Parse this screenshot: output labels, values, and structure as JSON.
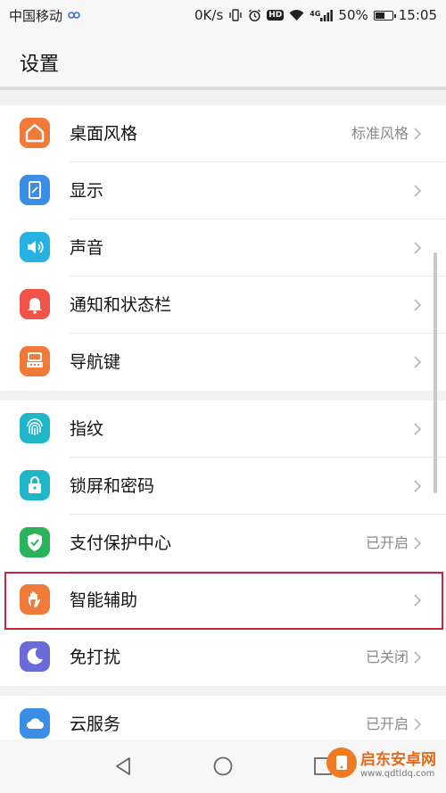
{
  "status_bar": {
    "carrier": "中国移动",
    "speed": "0K/s",
    "network": "4G",
    "battery": "50%",
    "battery_level": 0.5,
    "time": "15:05"
  },
  "header": {
    "title": "设置"
  },
  "groups": [
    [
      {
        "label": "桌面风格",
        "value": "标准风格",
        "icon": "home-icon",
        "color": "#f07a3a"
      },
      {
        "label": "显示",
        "value": "",
        "icon": "display-icon",
        "color": "#3b8ee5"
      },
      {
        "label": "声音",
        "value": "",
        "icon": "speaker-icon",
        "color": "#27b1e3"
      },
      {
        "label": "通知和状态栏",
        "value": "",
        "icon": "bell-icon",
        "color": "#f05449"
      },
      {
        "label": "导航键",
        "value": "",
        "icon": "dock-icon",
        "color": "#f07a3a"
      }
    ],
    [
      {
        "label": "指纹",
        "value": "",
        "icon": "fingerprint-icon",
        "color": "#1fb6c9"
      },
      {
        "label": "锁屏和密码",
        "value": "",
        "icon": "lock-icon",
        "color": "#1fb6c9"
      },
      {
        "label": "支付保护中心",
        "value": "已开启",
        "icon": "shield-icon",
        "color": "#29b35a"
      },
      {
        "label": "智能辅助",
        "value": "",
        "icon": "hand-icon",
        "color": "#f07a3a"
      },
      {
        "label": "免打扰",
        "value": "已关闭",
        "icon": "moon-icon",
        "color": "#6a6bd8"
      }
    ],
    [
      {
        "label": "云服务",
        "value": "已开启",
        "icon": "cloud-icon",
        "color": "#3b8ee5"
      }
    ]
  ],
  "watermark": {
    "title": "启东安卓网",
    "url": "www.qdtldq.com"
  }
}
